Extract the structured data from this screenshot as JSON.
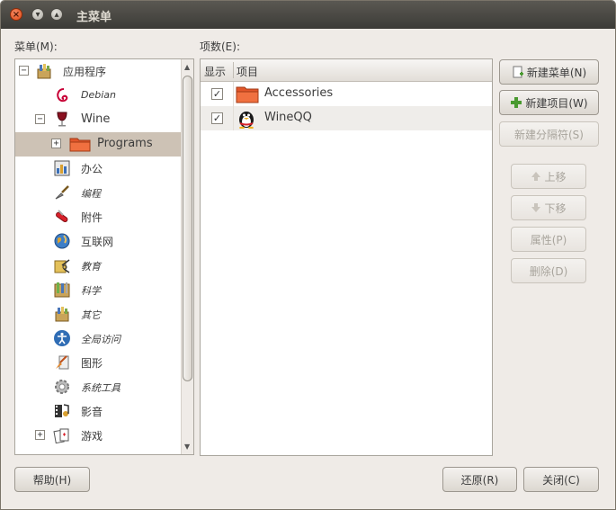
{
  "window": {
    "title": "主菜单"
  },
  "labels": {
    "menus": "菜单(M):",
    "items": "项数(E):"
  },
  "tree": {
    "rows": [
      {
        "label": "应用程序",
        "expander": "−"
      },
      {
        "label": "Debian"
      },
      {
        "label": "Wine",
        "expander": "−"
      },
      {
        "label": "Programs",
        "expander": "+"
      },
      {
        "label": "办公"
      },
      {
        "label": "编程"
      },
      {
        "label": "附件"
      },
      {
        "label": "互联网"
      },
      {
        "label": "教育"
      },
      {
        "label": "科学"
      },
      {
        "label": "其它"
      },
      {
        "label": "全局访问"
      },
      {
        "label": "图形"
      },
      {
        "label": "系统工具"
      },
      {
        "label": "影音"
      },
      {
        "label": "游戏",
        "expander": "+"
      }
    ]
  },
  "list": {
    "headers": {
      "show": "显示",
      "item": "项目"
    },
    "rows": [
      {
        "name": "Accessories",
        "checked": "✓"
      },
      {
        "name": "WineQQ",
        "checked": "✓"
      }
    ]
  },
  "buttons": {
    "new_menu": "新建菜单(N)",
    "new_item": "新建项目(W)",
    "new_separator": "新建分隔符(S)",
    "move_up": "上移",
    "move_down": "下移",
    "properties": "属性(P)",
    "delete": "删除(D)",
    "help": "帮助(H)",
    "revert": "还原(R)",
    "close": "关闭(C)"
  },
  "colors": {
    "titlebar": "#3c3b37",
    "window_bg": "#efebe7",
    "selection": "#cdc2b5",
    "close_button": "#df4a16"
  }
}
